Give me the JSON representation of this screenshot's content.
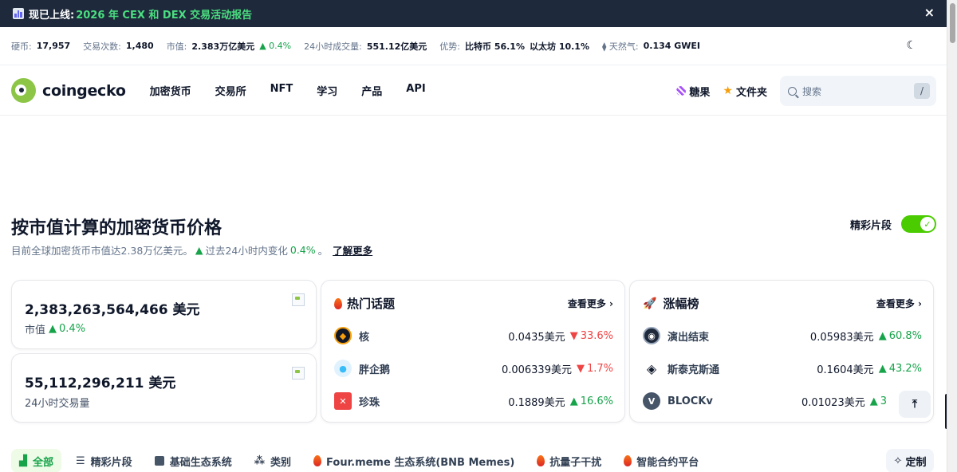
{
  "announcement": {
    "lead": "现已上线:",
    "link": "2026 年 CEX 和 DEX 交易活动报告",
    "close": "×"
  },
  "stats": {
    "coins_label": "硬币:",
    "coins_value": "17,957",
    "exchanges_label": "交易次数:",
    "exchanges_value": "1,480",
    "mcap_label": "市值:",
    "mcap_value": "2.383万亿美元",
    "mcap_change": "▲ 0.4%",
    "vol_label": "24小时成交量:",
    "vol_value": "551.12亿美元",
    "dominance_label": "优势:",
    "dominance_btc": "比特币 56.1%",
    "dominance_eth": "以太坊 10.1%",
    "gas_label": "⧫ 天然气:",
    "gas_value": "0.134 GWEI"
  },
  "nav": {
    "logo_text": "coingecko",
    "menu": [
      "加密货币",
      "交易所",
      "NFT",
      "学习",
      "产品",
      "API"
    ],
    "candy_label": "糖果",
    "portfolio_label": "文件夹",
    "search_placeholder": "搜索",
    "search_shortcut": "/"
  },
  "heading": {
    "title": "按市值计算的加密货币价格",
    "subtitle_pre": "目前全球加密货币市值达2.38万亿美元。",
    "subtitle_mid": "过去24小时内变化",
    "subtitle_change": "0.4%",
    "subtitle_post": "。",
    "learn_more": "了解更多",
    "highlights_label": "精彩片段",
    "highlights_enabled": true
  },
  "market_cap_card": {
    "value": "2,383,263,564,466 美元",
    "label": "市值",
    "change": "0.4%"
  },
  "volume_card": {
    "value": "55,112,296,211 美元",
    "label": "24小时交易量"
  },
  "trending": {
    "title": "热门话题",
    "see_more": "查看更多",
    "rows": [
      {
        "name": "核",
        "price": "0.0435美元",
        "change": "33.6%",
        "direction": "down",
        "icon_color": "#f59e0b",
        "icon_bg": "#111827"
      },
      {
        "name": "胖企鹅",
        "price": "0.006339美元",
        "change": "1.7%",
        "direction": "down",
        "icon_color": "#38bdf8",
        "icon_bg": "#e0f2fe"
      },
      {
        "name": "珍珠",
        "price": "0.1889美元",
        "change": "16.6%",
        "direction": "up",
        "icon_color": "#ef4444",
        "icon_bg": "#fff1f2"
      }
    ]
  },
  "gainers": {
    "title": "涨幅榜",
    "see_more": "查看更多",
    "rows": [
      {
        "name": "演出结束",
        "price": "0.05983美元",
        "change": "60.8%",
        "direction": "up",
        "icon_bg": "#1e293b"
      },
      {
        "name": "斯泰克斯通",
        "price": "0.1604美元",
        "change": "43.2%",
        "direction": "up",
        "icon_bg": "#ffffff"
      },
      {
        "name": "BLOCKv",
        "price": "0.01023美元",
        "change": "3",
        "direction": "up",
        "icon_bg": "#475569"
      }
    ]
  },
  "tabs": [
    "全部",
    "精彩片段",
    "基础生态系统",
    "类别",
    "Four.meme 生态系统(BNB Memes)",
    "抗量子干扰",
    "智能合约平台"
  ],
  "customize_label": "定制",
  "colors": {
    "green": "#16a34a",
    "red": "#ef4444",
    "navy": "#1e293b",
    "brand": "#8dc647"
  }
}
